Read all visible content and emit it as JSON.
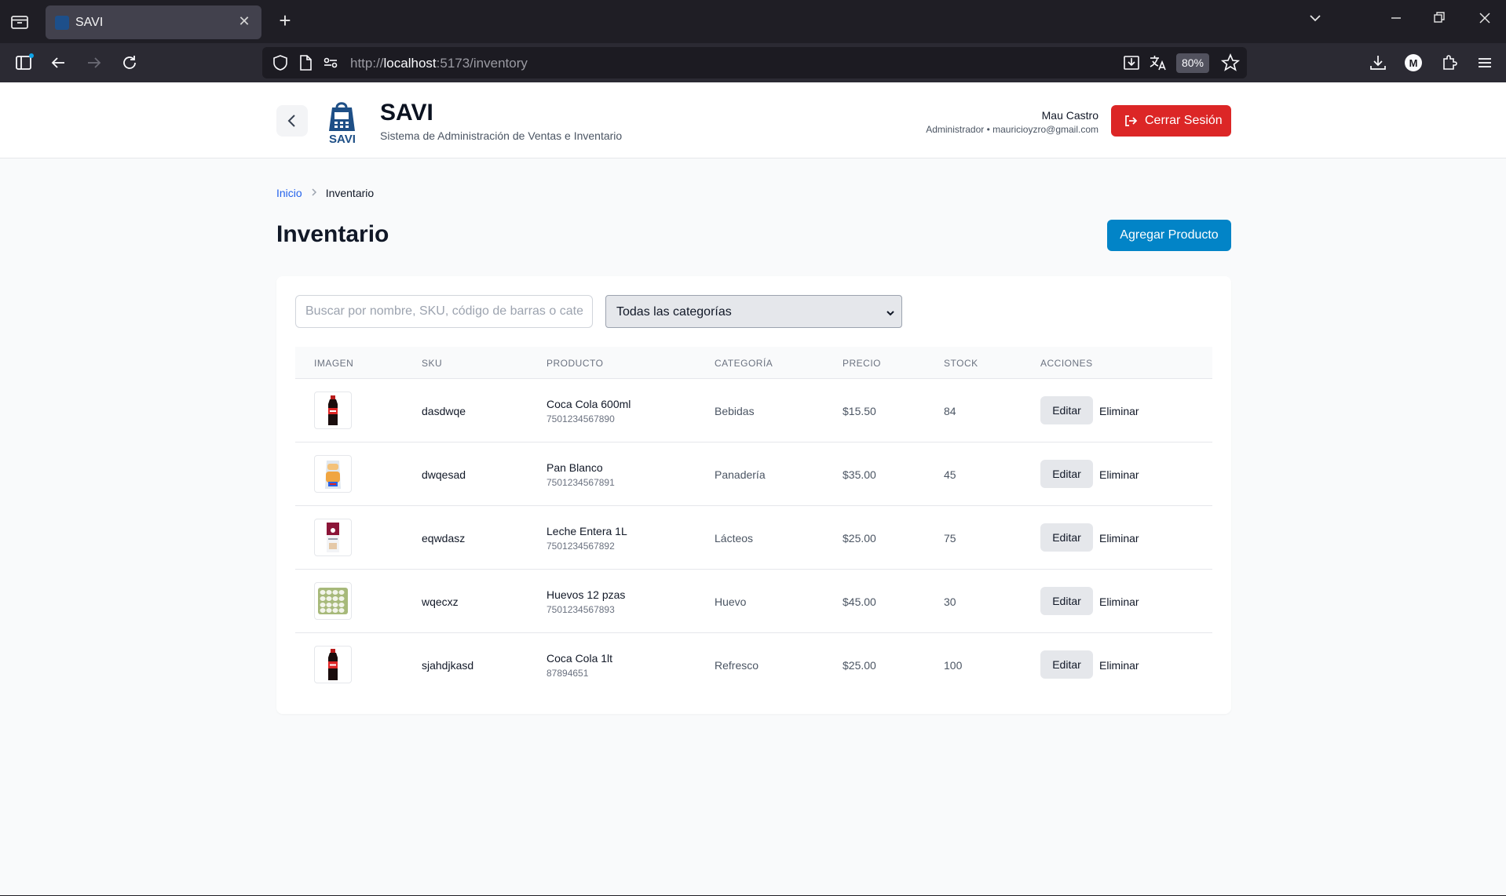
{
  "browser": {
    "tab_title": "SAVI",
    "url_prefix": "http://",
    "url_host": "localhost",
    "url_rest": ":5173/inventory",
    "zoom": "80%",
    "profile_initial": "M"
  },
  "header": {
    "brand_title": "SAVI",
    "brand_subtitle": "Sistema de Administración de Ventas e Inventario",
    "logo_text": "SAVI",
    "user_name": "Mau Castro",
    "user_meta": "Administrador • mauricioyzro@gmail.com",
    "logout_label": "Cerrar Sesión"
  },
  "breadcrumb": {
    "home": "Inicio",
    "current": "Inventario"
  },
  "page": {
    "title": "Inventario",
    "add_label": "Agregar Producto"
  },
  "filters": {
    "search_placeholder": "Buscar por nombre, SKU, código de barras o categoría",
    "category_selected": "Todas las categorías"
  },
  "table": {
    "columns": [
      "Imagen",
      "SKU",
      "Producto",
      "Categoría",
      "Precio",
      "Stock",
      "Acciones"
    ],
    "edit_label": "Editar",
    "delete_label": "Eliminar",
    "rows": [
      {
        "image": "coca-cola-bottle",
        "sku": "dasdwqe",
        "product": "Coca Cola 600ml",
        "barcode": "7501234567890",
        "category": "Bebidas",
        "price": "$15.50",
        "stock": "84"
      },
      {
        "image": "bread-bag",
        "sku": "dwqesad",
        "product": "Pan Blanco",
        "barcode": "7501234567891",
        "category": "Panadería",
        "price": "$35.00",
        "stock": "45"
      },
      {
        "image": "milk-carton",
        "sku": "eqwdasz",
        "product": "Leche Entera 1L",
        "barcode": "7501234567892",
        "category": "Lácteos",
        "price": "$25.00",
        "stock": "75"
      },
      {
        "image": "egg-tray",
        "sku": "wqecxz",
        "product": "Huevos 12 pzas",
        "barcode": "7501234567893",
        "category": "Huevo",
        "price": "$45.00",
        "stock": "30"
      },
      {
        "image": "coca-cola-bottle",
        "sku": "sjahdjkasd",
        "product": "Coca Cola 1lt",
        "barcode": "87894651",
        "category": "Refresco",
        "price": "$25.00",
        "stock": "100"
      }
    ]
  },
  "colors": {
    "accent_blue": "#0284c7",
    "danger_red": "#dc2626",
    "link_blue": "#2563eb",
    "brand_navy": "#1e4f86"
  }
}
